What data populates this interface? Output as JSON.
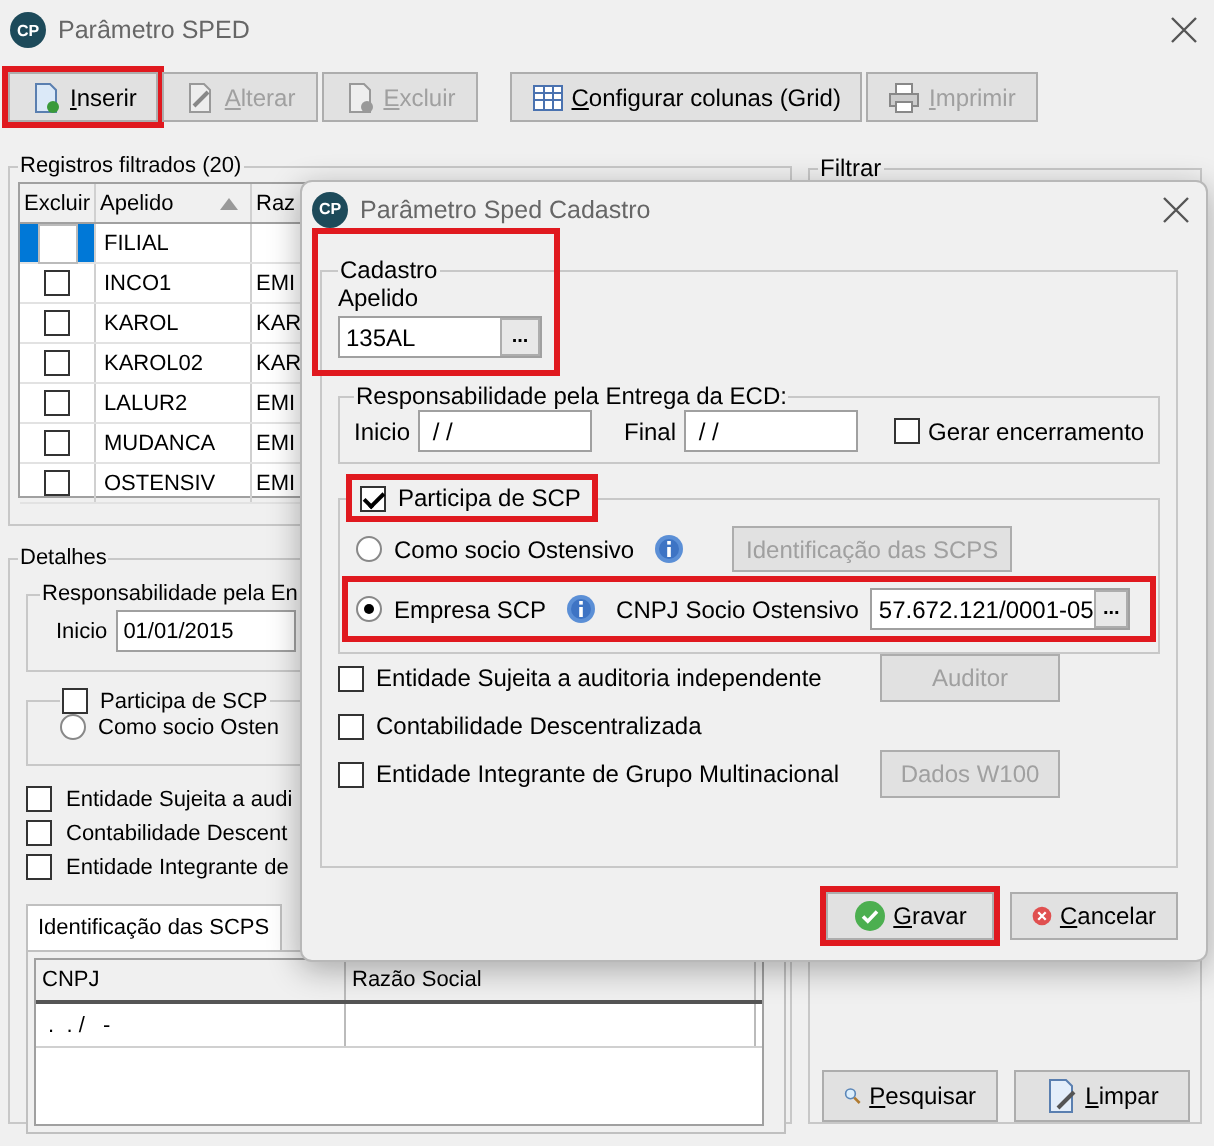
{
  "window": {
    "badge": "CP",
    "title": "Parâmetro SPED"
  },
  "toolbar": [
    {
      "label": "Inserir",
      "disabled": false,
      "highlighted": true
    },
    {
      "label": "Alterar",
      "disabled": true,
      "highlighted": false
    },
    {
      "label": "Excluir",
      "disabled": true,
      "highlighted": false
    },
    {
      "label": "Configurar colunas (Grid)",
      "disabled": false,
      "highlighted": false
    },
    {
      "label": "Imprimir",
      "disabled": true,
      "highlighted": false
    }
  ],
  "records": {
    "title": "Registros filtrados (20)",
    "columns": [
      "Excluir",
      "Apelido",
      "Raz"
    ],
    "rows": [
      {
        "checked": false,
        "apelido": "FILIAL",
        "selected": true
      },
      {
        "checked": false,
        "apelido": "INCO1",
        "column_3": "EMI",
        "selected": false
      },
      {
        "checked": false,
        "apelido": "KAROL",
        "column_3": "KAR",
        "selected": false
      },
      {
        "checked": false,
        "apelido": "KAROL02",
        "column_3": "KAR",
        "selected": false
      },
      {
        "checked": false,
        "apelido": "LALUR2",
        "column_3": "EMI",
        "selected": false
      },
      {
        "checked": false,
        "apelido": "MUDANCA",
        "column_3": "EMI",
        "selected": false
      },
      {
        "checked": false,
        "apelido": "OSTENSIV",
        "column_3": "EMI",
        "selected": false
      }
    ]
  },
  "details": {
    "title": "Detalhes",
    "responsibility": {
      "title": "Responsabilidade pela En",
      "start_label": "Inicio",
      "start_value": "01/01/2015"
    },
    "scp": {
      "label": "Participa de SCP",
      "checked": false,
      "radio_label": "Como socio Osten",
      "radio_selected": false
    },
    "checks": [
      {
        "label": "Entidade Sujeita a audi",
        "checked": false
      },
      {
        "label": "Contabilidade Descent",
        "checked": false
      },
      {
        "label": "Entidade Integrante de",
        "checked": false
      }
    ],
    "tabs": [
      {
        "label": "Identificação das SCPS",
        "selected": true
      }
    ],
    "grid": {
      "columns": [
        "CNPJ",
        "Razão Social"
      ],
      "rows": [
        {
          "cnpj": " .  . /   -"
        }
      ]
    }
  },
  "filter": {
    "title": "Filtrar",
    "buttons": [
      {
        "label": "Pesquisar"
      },
      {
        "label": "Limpar"
      }
    ]
  },
  "dialog": {
    "badge": "CP",
    "title": "Parâmetro Sped Cadastro",
    "cadastro": {
      "title": "Cadastro",
      "highlighted": true,
      "apelido_label": "Apelido",
      "apelido_value": "135AL",
      "lookup_label": "..."
    },
    "responsibility": {
      "title": "Responsabilidade pela Entrega da ECD:",
      "start_label": "Inicio",
      "start_value": " / /",
      "end_label": "Final",
      "end_value": " / /",
      "closing_label": "Gerar encerramento",
      "closing_checked": false
    },
    "scp": {
      "label": "Participa de SCP",
      "checked": true,
      "highlighted": true,
      "options": [
        {
          "label": "Como socio Ostensivo",
          "selected": false,
          "highlighted": false,
          "button": {
            "label": "Identificação das SCPS",
            "disabled": true
          }
        },
        {
          "label": "Empresa SCP",
          "selected": true,
          "highlighted": true,
          "cnpj_label": "CNPJ Socio Ostensivo",
          "cnpj_value": "57.672.121/0001-05",
          "lookup_label": "..."
        }
      ]
    },
    "checks": [
      {
        "label": "Entidade Sujeita a auditoria independente",
        "checked": false,
        "button": {
          "label": "Auditor",
          "disabled": true
        }
      },
      {
        "label": "Contabilidade Descentralizada",
        "checked": false
      },
      {
        "label": "Entidade Integrante de Grupo Multinacional",
        "checked": false,
        "button": {
          "label": "Dados W100",
          "disabled": true
        }
      }
    ],
    "buttons": [
      {
        "label": "Gravar",
        "highlighted": true
      },
      {
        "label": "Cancelar",
        "highlighted": false
      }
    ]
  }
}
